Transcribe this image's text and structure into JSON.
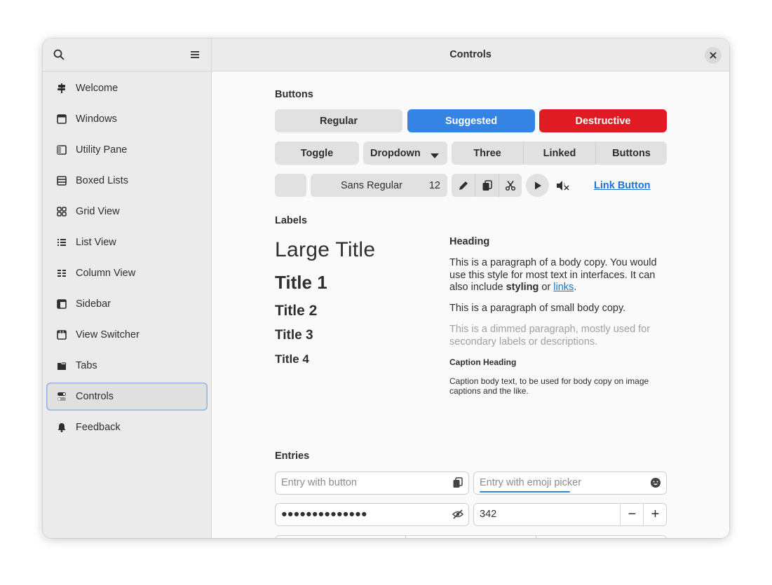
{
  "window": {
    "title": "Controls"
  },
  "sidebar": {
    "search_icon": "search-icon",
    "menu_icon": "hamburger-menu-icon",
    "items": [
      {
        "label": "Welcome",
        "icon": "signpost-icon"
      },
      {
        "label": "Windows",
        "icon": "window-icon"
      },
      {
        "label": "Utility Pane",
        "icon": "sidebar-pane-icon"
      },
      {
        "label": "Boxed Lists",
        "icon": "boxed-list-icon"
      },
      {
        "label": "Grid View",
        "icon": "grid-icon"
      },
      {
        "label": "List View",
        "icon": "list-icon"
      },
      {
        "label": "Column View",
        "icon": "column-view-icon"
      },
      {
        "label": "Sidebar",
        "icon": "sidebar-icon"
      },
      {
        "label": "View Switcher",
        "icon": "view-switcher-icon"
      },
      {
        "label": "Tabs",
        "icon": "tabs-icon"
      },
      {
        "label": "Controls",
        "icon": "toggles-icon",
        "selected": true
      },
      {
        "label": "Feedback",
        "icon": "bell-icon"
      }
    ]
  },
  "buttons": {
    "title": "Buttons",
    "regular": "Regular",
    "suggested": "Suggested",
    "destructive": "Destructive",
    "toggle": "Toggle",
    "dropdown": "Dropdown",
    "linked": [
      "Three",
      "Linked",
      "Buttons"
    ],
    "font_name": "Sans Regular",
    "font_size": "12",
    "link_button": "Link Button"
  },
  "labels": {
    "title": "Labels",
    "large_title": "Large Title",
    "title1": "Title 1",
    "title2": "Title 2",
    "title3": "Title 3",
    "title4": "Title 4",
    "heading": "Heading",
    "body_part1": "This is a paragraph of a body copy. You would use this style for most text in interfaces. It can also include ",
    "body_bold": "styling",
    "body_or": " or ",
    "body_link": "links",
    "body_end": ".",
    "small_body": "This is a paragraph of small body copy.",
    "dimmed": "This is a dimmed paragraph, mostly used for secondary labels or descriptions.",
    "caption_heading": "Caption Heading",
    "caption_body": "Caption body text, to be used for body copy on image captions and the like."
  },
  "entries": {
    "title": "Entries",
    "entry_button_placeholder": "Entry with button",
    "entry_emoji_placeholder": "Entry with emoji picker",
    "password_value": "●●●●●●●●●●●●●●",
    "spin_value": "342",
    "minus": "−",
    "plus": "+"
  },
  "colors": {
    "accent": "#3584e4",
    "destructive": "#e01b24",
    "link": "#1c71d8"
  }
}
